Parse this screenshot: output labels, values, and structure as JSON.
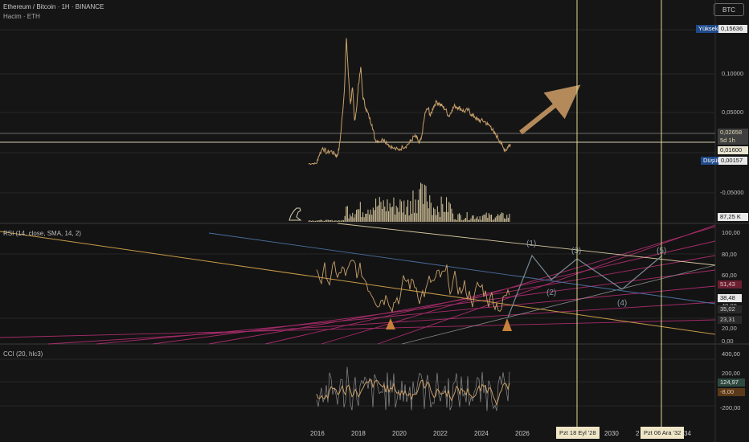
{
  "header": {
    "symbol_title": "Ethereum / Bitcoin · 1H · BINANCE",
    "volume_label": "Hacim · ETH",
    "currency_button": "BTC"
  },
  "price_axis": {
    "high_label": "Yüksek",
    "high_value": "0,15636",
    "low_label": "Düşük",
    "low_value": "0,00157",
    "ticks": [
      "0,10000",
      "0,05000",
      "-0,05000"
    ],
    "current_price": "0,02658",
    "countdown": "5d 1h",
    "level_016": "0,01600",
    "volume_value": "87,25 K"
  },
  "rsi": {
    "label": "RSI (14, close, SMA, 14, 2)",
    "ticks": [
      "100,00",
      "80,00",
      "60,00",
      "40,00",
      "20,00",
      "0,00"
    ],
    "values": [
      "51,43",
      "38,48",
      "35,02",
      "23,31"
    ]
  },
  "cci": {
    "label": "CCI (20, hlc3)",
    "ticks": [
      "400,00",
      "200,00",
      "-200,00"
    ],
    "values": [
      "124,97",
      "-8,00"
    ]
  },
  "time_axis": {
    "ticks": [
      "2016",
      "2018",
      "2020",
      "2022",
      "2024",
      "2026",
      "2030",
      "2",
      "34"
    ],
    "cursor_label_1": "Pzt 18 Eyl '28",
    "cursor_label_2": "Pzt 06 Ara '32"
  },
  "waves": [
    "(1)",
    "(2)",
    "(3)",
    "(4)",
    "(5)"
  ],
  "colors": {
    "background": "#151515",
    "price_line": "#c8a06a",
    "arrow": "#b48a5a",
    "cursor_line": "#e0d890",
    "wave_line": "#7a8a95",
    "rsi_fan": "#c0307a",
    "rsi_channel_upper": "#d8c8a0",
    "rsi_channel_lower": "#c89a48",
    "rsi_blue_line": "#4a6fa0"
  },
  "chart_data": {
    "type": "line",
    "title": "Ethereum / Bitcoin · 1H · BINANCE",
    "x_unit": "year",
    "xlim": [
      2015.5,
      2034.5
    ],
    "ylim": [
      -0.08,
      0.17
    ],
    "series": [
      {
        "name": "ETHBTC",
        "points": [
          [
            2015.6,
            0.0025
          ],
          [
            2015.8,
            0.0028
          ],
          [
            2016.0,
            0.003
          ],
          [
            2016.1,
            0.012
          ],
          [
            2016.3,
            0.022
          ],
          [
            2016.5,
            0.016
          ],
          [
            2016.7,
            0.018
          ],
          [
            2016.9,
            0.014
          ],
          [
            2017.0,
            0.012
          ],
          [
            2017.1,
            0.022
          ],
          [
            2017.2,
            0.045
          ],
          [
            2017.35,
            0.09
          ],
          [
            2017.45,
            0.155
          ],
          [
            2017.55,
            0.11
          ],
          [
            2017.65,
            0.075
          ],
          [
            2017.75,
            0.095
          ],
          [
            2017.85,
            0.055
          ],
          [
            2017.95,
            0.07
          ],
          [
            2018.05,
            0.1
          ],
          [
            2018.15,
            0.12
          ],
          [
            2018.25,
            0.085
          ],
          [
            2018.4,
            0.07
          ],
          [
            2018.55,
            0.06
          ],
          [
            2018.7,
            0.05
          ],
          [
            2018.85,
            0.032
          ],
          [
            2019.0,
            0.03
          ],
          [
            2019.3,
            0.032
          ],
          [
            2019.5,
            0.026
          ],
          [
            2019.7,
            0.022
          ],
          [
            2020.0,
            0.019
          ],
          [
            2020.2,
            0.023
          ],
          [
            2020.4,
            0.025
          ],
          [
            2020.6,
            0.03
          ],
          [
            2020.75,
            0.036
          ],
          [
            2020.9,
            0.034
          ],
          [
            2021.0,
            0.027
          ],
          [
            2021.1,
            0.032
          ],
          [
            2021.3,
            0.065
          ],
          [
            2021.45,
            0.07
          ],
          [
            2021.55,
            0.06
          ],
          [
            2021.7,
            0.072
          ],
          [
            2021.85,
            0.078
          ],
          [
            2022.0,
            0.075
          ],
          [
            2022.15,
            0.072
          ],
          [
            2022.3,
            0.068
          ],
          [
            2022.45,
            0.06
          ],
          [
            2022.6,
            0.068
          ],
          [
            2022.75,
            0.073
          ],
          [
            2022.9,
            0.071
          ],
          [
            2023.05,
            0.069
          ],
          [
            2023.2,
            0.066
          ],
          [
            2023.4,
            0.068
          ],
          [
            2023.55,
            0.062
          ],
          [
            2023.7,
            0.06
          ],
          [
            2023.85,
            0.056
          ],
          [
            2024.0,
            0.055
          ],
          [
            2024.2,
            0.054
          ],
          [
            2024.35,
            0.05
          ],
          [
            2024.5,
            0.048
          ],
          [
            2024.65,
            0.04
          ],
          [
            2024.8,
            0.036
          ],
          [
            2024.95,
            0.03
          ],
          [
            2025.1,
            0.022
          ],
          [
            2025.25,
            0.019
          ],
          [
            2025.35,
            0.024
          ],
          [
            2025.45,
            0.0266
          ]
        ]
      }
    ]
  }
}
